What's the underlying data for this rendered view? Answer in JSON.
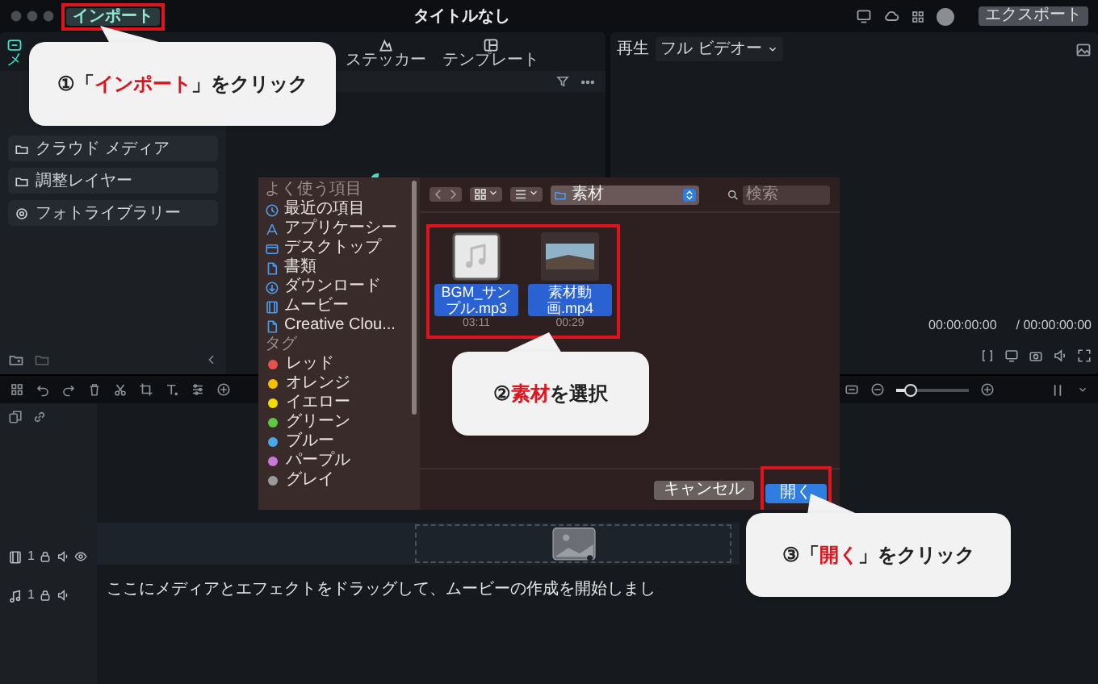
{
  "window": {
    "title": "タイトルなし",
    "import_button": "インポート",
    "export_button": "エクスポート"
  },
  "toolbar_tabs": [
    {
      "label": "メ",
      "selected": true
    },
    {
      "label": "ステッカー",
      "selected": false
    },
    {
      "label": "テンプレート",
      "selected": false
    }
  ],
  "sidebar": {
    "items": [
      {
        "label": "クラウド メディア"
      },
      {
        "label": "調整レイヤー"
      },
      {
        "label": "フォトライブラリー"
      }
    ]
  },
  "preview": {
    "label": "再生",
    "quality_dropdown": "フル ビデオー",
    "current_time": "00:00:00:00",
    "total_time": "/ 00:00:00:00"
  },
  "timeline": {
    "zoom": {
      "level": 0.2
    },
    "tracks": [
      {
        "kind": "video",
        "number": "1"
      },
      {
        "kind": "audio",
        "number": "1"
      }
    ],
    "drop_hint": "ここにメディアとエフェクトをドラッグして、ムービーの作成を開始しまし"
  },
  "open_dialog": {
    "sidebar_sections": [
      {
        "heading": "よく使う項目",
        "items": [
          {
            "label": "最近の項目"
          },
          {
            "label": "アプリケーシー"
          },
          {
            "label": "デスクトップ"
          },
          {
            "label": "書類"
          },
          {
            "label": "ダウンロード"
          },
          {
            "label": "ムービー"
          },
          {
            "label": "Creative Clou..."
          }
        ]
      },
      {
        "heading": "タグ",
        "items": [
          {
            "label": "レッド",
            "color": "#e5534b"
          },
          {
            "label": "オレンジ",
            "color": "#f2c200"
          },
          {
            "label": "イエロー",
            "color": "#f5dc00"
          },
          {
            "label": "グリーン",
            "color": "#5cc843"
          },
          {
            "label": "ブルー",
            "color": "#4aa8e8"
          },
          {
            "label": "パープル",
            "color": "#c77ad8"
          },
          {
            "label": "グレイ",
            "color": "#9a9a9a"
          }
        ]
      }
    ],
    "location": "素材",
    "search": {
      "placeholder": "検索"
    },
    "files": [
      {
        "name": "BGM_サンプル.mp3",
        "duration": "03:11",
        "kind": "audio",
        "selected": true
      },
      {
        "name": "素材動画.mp4",
        "duration": "00:29",
        "kind": "video",
        "selected": true
      }
    ],
    "buttons": [
      {
        "label": "キャンセル",
        "kind": "secondary"
      },
      {
        "label": "開く",
        "kind": "primary"
      }
    ]
  },
  "callouts": [
    {
      "before": "①「",
      "highlight": "インポート",
      "after": "」をクリック"
    },
    {
      "before": "②",
      "highlight": "素材",
      "after": "を選択"
    },
    {
      "before": "③「",
      "highlight": "開く",
      "after": "」をクリック"
    }
  ]
}
